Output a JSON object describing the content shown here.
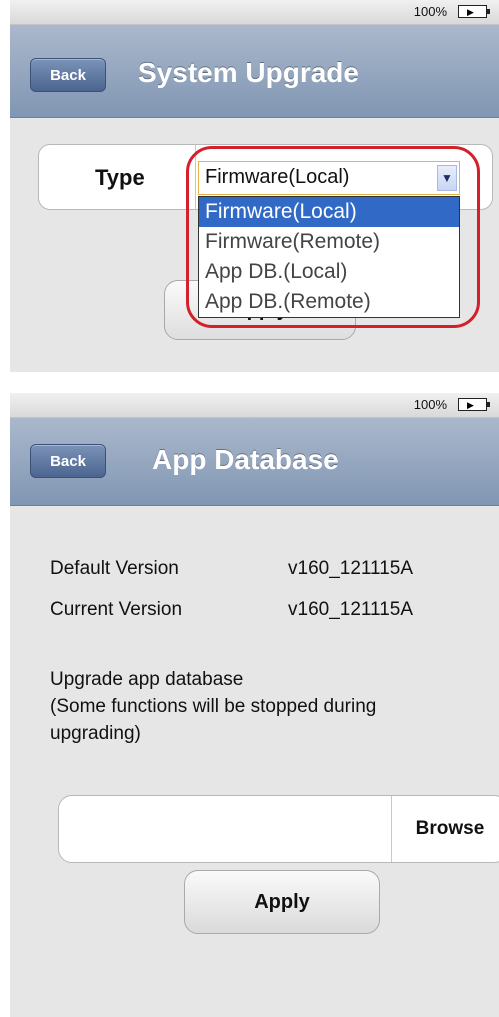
{
  "screen1": {
    "status": {
      "battery_text": "100%",
      "battery_icon": "battery-charging-icon"
    },
    "nav": {
      "back_label": "Back",
      "title": "System Upgrade"
    },
    "type_label": "Type",
    "select": {
      "value": "Firmware(Local)",
      "options": [
        "Firmware(Local)",
        "Firmware(Remote)",
        "App DB.(Local)",
        "App DB.(Remote)"
      ]
    },
    "apply_label": "Apply",
    "colors": {
      "selected_option": "#3169c6",
      "highlight_ring": "#d3202b"
    }
  },
  "screen2": {
    "status": {
      "battery_text": "100%",
      "battery_icon": "battery-charging-icon"
    },
    "nav": {
      "back_label": "Back",
      "title": "App Database"
    },
    "default_version_label": "Default Version",
    "default_version_value": "v160_121115A",
    "current_version_label": "Current Version",
    "current_version_value": "v160_121115A",
    "upgrade_heading": "Upgrade app database",
    "upgrade_note_line1": "(Some functions will be stopped during",
    "upgrade_note_line2": "upgrading)",
    "file_input_value": "",
    "browse_label": "Browse",
    "apply_label": "Apply"
  }
}
